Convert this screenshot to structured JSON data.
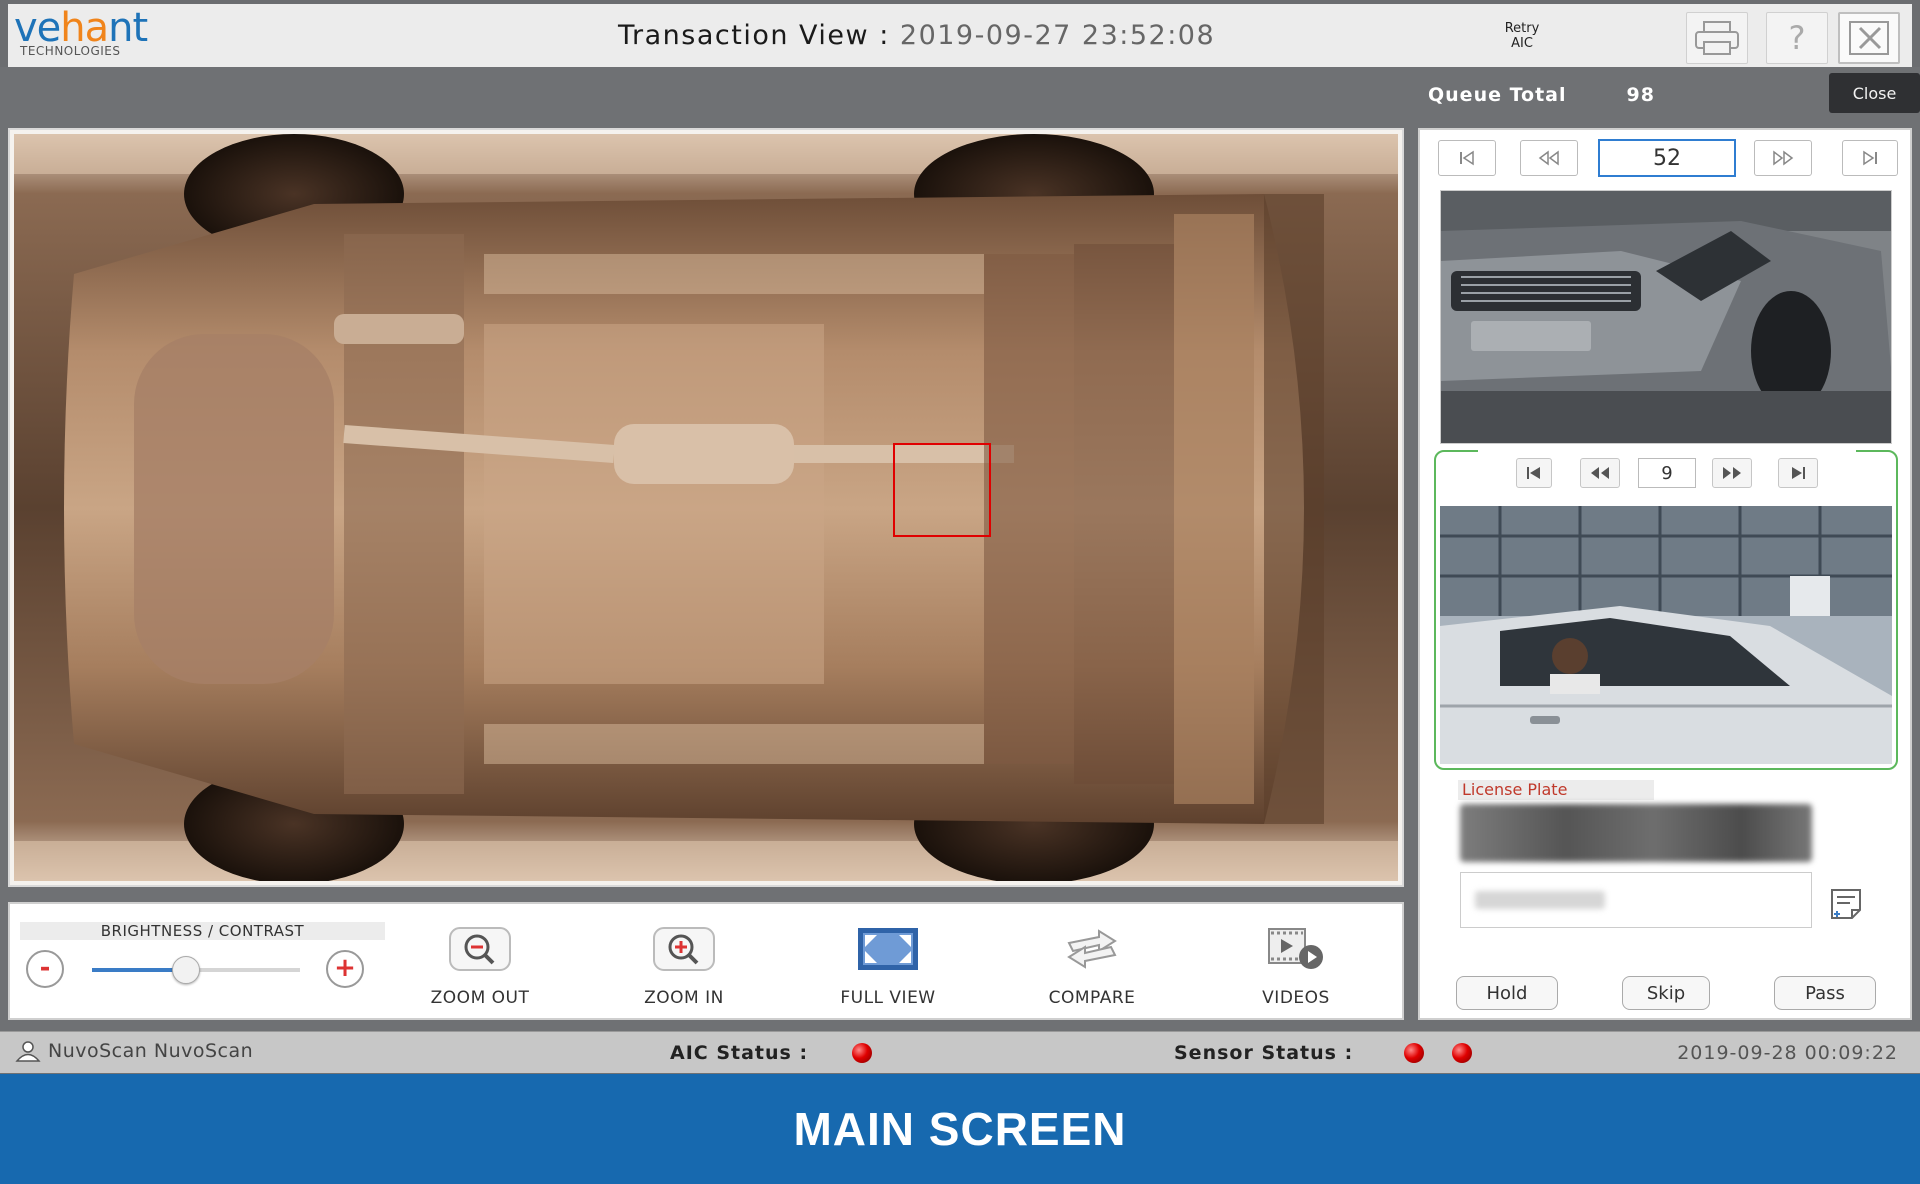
{
  "app": {
    "logo_main": "vehant",
    "logo_sub": "TECHNOLOGIES",
    "title_label": "Transaction View",
    "title_sep": " : ",
    "transaction_time": "2019-09-27 23:52:08",
    "retry_label": "Retry",
    "retry_sub": "AIC",
    "tooltip_close": "Close"
  },
  "queue": {
    "label": "Queue Total",
    "value": "98"
  },
  "image_nav": {
    "current": "52"
  },
  "camera_nav": {
    "current": "9"
  },
  "toolbar": {
    "brightness_label": "BRIGHTNESS / CONTRAST",
    "minus": "-",
    "plus": "+",
    "brightness_level": 0.45,
    "zoom_out": "ZOOM OUT",
    "zoom_in": "ZOOM IN",
    "full_view": "FULL VIEW",
    "compare": "COMPARE",
    "videos": "VIDEOS"
  },
  "license": {
    "label": "License Plate"
  },
  "actions": {
    "hold": "Hold",
    "skip": "Skip",
    "pass": "Pass"
  },
  "status": {
    "user": "NuvoScan NuvoScan",
    "aic_label": "AIC Status :",
    "sensor_label": "Sensor Status :",
    "datetime": "2019-09-28 00:09:22"
  },
  "footer": {
    "caption": "MAIN SCREEN"
  },
  "colors": {
    "accent": "#1769af",
    "status_led": "#e00000",
    "detection_box": "#e00000",
    "camera_border": "#5cb85c"
  },
  "icons": [
    "printer-icon",
    "help-icon",
    "close-icon",
    "first-icon",
    "prev-icon",
    "next-icon",
    "last-icon",
    "zoom-out-icon",
    "zoom-in-icon",
    "full-view-icon",
    "compare-icon",
    "videos-icon",
    "note-icon",
    "user-icon"
  ]
}
